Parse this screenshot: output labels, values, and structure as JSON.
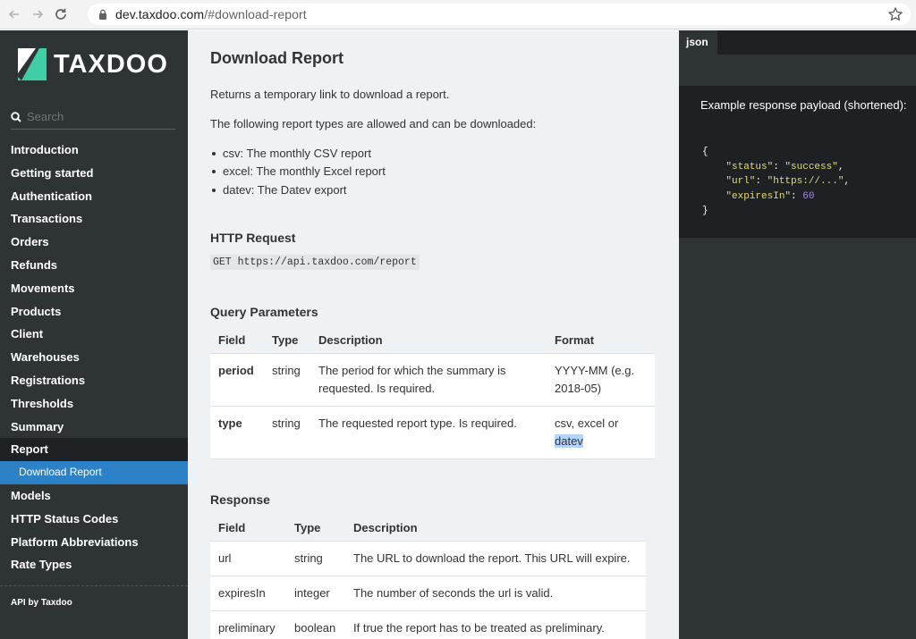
{
  "browser": {
    "url_host": "dev.taxdoo.com",
    "url_path": "/#download-report"
  },
  "sidebar": {
    "logo_text": "TAXDOO",
    "search_placeholder": "Search",
    "items": [
      {
        "label": "Introduction"
      },
      {
        "label": "Getting started"
      },
      {
        "label": "Authentication"
      },
      {
        "label": "Transactions"
      },
      {
        "label": "Orders"
      },
      {
        "label": "Refunds"
      },
      {
        "label": "Movements"
      },
      {
        "label": "Products"
      },
      {
        "label": "Client"
      },
      {
        "label": "Warehouses"
      },
      {
        "label": "Registrations"
      },
      {
        "label": "Thresholds"
      },
      {
        "label": "Summary"
      },
      {
        "label": "Report"
      },
      {
        "label": "Download Report"
      },
      {
        "label": "Models"
      },
      {
        "label": "HTTP Status Codes"
      },
      {
        "label": "Platform Abbreviations"
      },
      {
        "label": "Rate Types"
      }
    ],
    "footer": "API by Taxdoo"
  },
  "content": {
    "title": "Download Report",
    "intro": "Returns a temporary link to download a report.",
    "types_intro": "The following report types are allowed and can be downloaded:",
    "types": [
      "csv: The monthly CSV report",
      "excel: The monthly Excel report",
      "datev: The Datev export"
    ],
    "http_heading": "HTTP Request",
    "http_request": "GET https://api.taxdoo.com/report",
    "query_heading": "Query Parameters",
    "query_table": {
      "headers": [
        "Field",
        "Type",
        "Description",
        "Format"
      ],
      "rows": [
        {
          "field": "period",
          "type": "string",
          "description": "The period for which the summary is requested. Is required.",
          "format": "YYYY-MM (e.g. 2018-05)"
        },
        {
          "field": "type",
          "type": "string",
          "description": "The requested report type. Is required.",
          "format_a": "csv, excel or",
          "format_b": "datev"
        }
      ]
    },
    "response_heading": "Response",
    "response_table": {
      "headers": [
        "Field",
        "Type",
        "Description"
      ],
      "rows": [
        {
          "field": "url",
          "type": "string",
          "description": "The URL to download the report. This URL will expire."
        },
        {
          "field": "expiresIn",
          "type": "integer",
          "description": "The number of seconds the url is valid."
        },
        {
          "field": "preliminary",
          "type": "boolean",
          "description": "If true the report has to be treated as preliminary."
        }
      ]
    }
  },
  "code_panel": {
    "tab_label": "json",
    "description": "Example response payload (shortened):",
    "code": {
      "open": "{",
      "key1": "\"status\"",
      "val1": "\"success\"",
      "key2": "\"url\"",
      "val2": "\"https://...\"",
      "key3": "\"expiresIn\"",
      "val3": "60",
      "close": "}"
    }
  },
  "colors": {
    "sidebar_bg": "#2e3336",
    "active_item": "#2d81c7",
    "content_bg": "#eef2f5",
    "code_bg": "#1d2124"
  }
}
